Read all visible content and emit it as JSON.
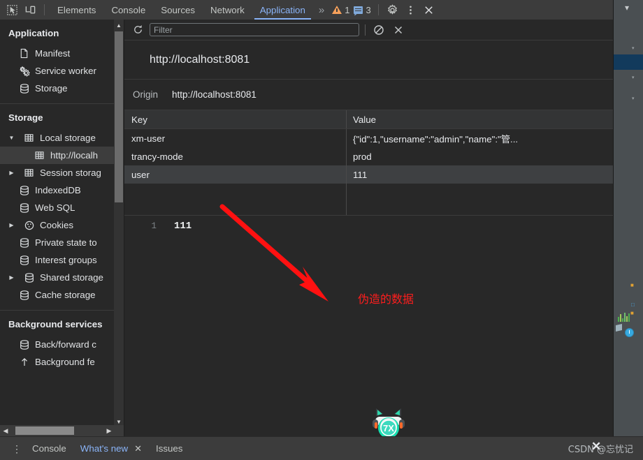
{
  "window": {
    "toolbar_icons": [
      "inspect-element-icon",
      "device-toolbar-icon"
    ],
    "tabs": [
      {
        "label": "Elements",
        "active": false
      },
      {
        "label": "Console",
        "active": false
      },
      {
        "label": "Sources",
        "active": false
      },
      {
        "label": "Network",
        "active": false
      },
      {
        "label": "Application",
        "active": true
      }
    ],
    "more_tabs_label": "»",
    "warning_count": "1",
    "message_count": "3",
    "settings_icon": "gear-icon",
    "more_options_icon": "kebab-icon",
    "close_icon": "close-icon"
  },
  "sidebar": {
    "groups": [
      {
        "title": "Application",
        "items": [
          {
            "label": "Manifest",
            "icon": "document-icon",
            "arrow": "",
            "indent": 1,
            "selected": false
          },
          {
            "label": "Service worker",
            "icon": "gears-icon",
            "arrow": "",
            "indent": 1,
            "selected": false
          },
          {
            "label": "Storage",
            "icon": "database-icon",
            "arrow": "",
            "indent": 1,
            "selected": false
          }
        ]
      },
      {
        "title": "Storage",
        "items": [
          {
            "label": "Local storage",
            "icon": "table-icon",
            "arrow": "▼",
            "indent": 1,
            "selected": false
          },
          {
            "label": "http://localh",
            "icon": "table-icon",
            "arrow": "",
            "indent": 2,
            "selected": true
          },
          {
            "label": "Session storag",
            "icon": "table-icon",
            "arrow": "▶",
            "indent": 1,
            "selected": false
          },
          {
            "label": "IndexedDB",
            "icon": "database-icon",
            "arrow": "",
            "indent": 1,
            "selected": false
          },
          {
            "label": "Web SQL",
            "icon": "database-icon",
            "arrow": "",
            "indent": 1,
            "selected": false
          },
          {
            "label": "Cookies",
            "icon": "cookie-icon",
            "arrow": "▶",
            "indent": 1,
            "selected": false
          },
          {
            "label": "Private state to",
            "icon": "database-icon",
            "arrow": "",
            "indent": 1,
            "selected": false
          },
          {
            "label": "Interest groups",
            "icon": "database-icon",
            "arrow": "",
            "indent": 1,
            "selected": false
          },
          {
            "label": "Shared storage",
            "icon": "database-icon",
            "arrow": "▶",
            "indent": 1,
            "selected": false
          },
          {
            "label": "Cache storage",
            "icon": "database-icon",
            "arrow": "",
            "indent": 1,
            "selected": false
          }
        ]
      },
      {
        "title": "Background services",
        "items": [
          {
            "label": "Back/forward c",
            "icon": "database-icon",
            "arrow": "",
            "indent": 1,
            "selected": false
          },
          {
            "label": "Background fe",
            "icon": "upload-icon",
            "arrow": "",
            "indent": 1,
            "selected": false
          }
        ]
      }
    ]
  },
  "panel": {
    "refresh_icon": "refresh-icon",
    "filter_placeholder": "Filter",
    "filter_value": "",
    "clear_all_icon": "clear-all-icon",
    "delete_selected_icon": "delete-selected-icon",
    "url_title": "http://localhost:8081",
    "origin_label": "Origin",
    "origin_value": "http://localhost:8081",
    "table": {
      "columns": [
        "Key",
        "Value"
      ],
      "rows": [
        {
          "key": "xm-user",
          "value": "{\"id\":1,\"username\":\"admin\",\"name\":\"管...",
          "selected": false
        },
        {
          "key": "trancy-mode",
          "value": "prod",
          "selected": false
        },
        {
          "key": "user",
          "value": "111",
          "selected": true
        }
      ]
    },
    "preview": {
      "line_number": "1",
      "value": "111"
    },
    "annotation": {
      "text": "伪造的数据",
      "color": "#ff1d1d"
    }
  },
  "drawer": {
    "more_icon": "kebab-icon",
    "tabs": [
      {
        "label": "Console",
        "active": false,
        "closable": false
      },
      {
        "label": "What's new",
        "active": true,
        "closable": true
      },
      {
        "label": "Issues",
        "active": false,
        "closable": false
      }
    ]
  },
  "watermark": "CSDN @忘忧记"
}
